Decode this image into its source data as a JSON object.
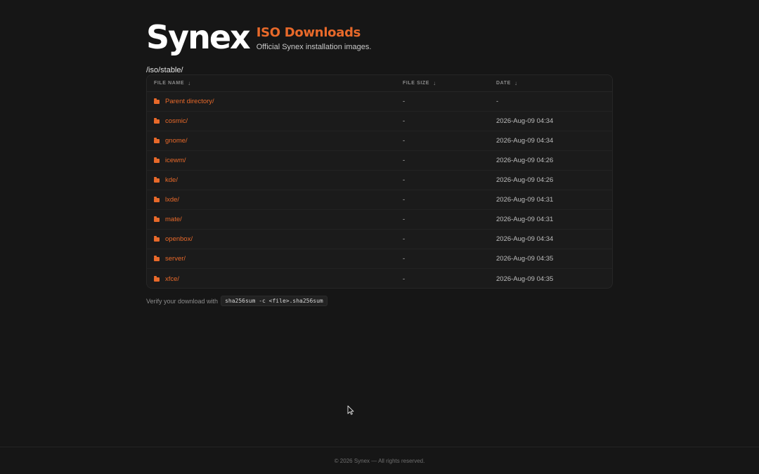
{
  "brand": {
    "logo_text": "Synex",
    "title": "ISO Downloads",
    "subtitle": "Official Synex installation images."
  },
  "path": "/iso/stable/",
  "table": {
    "headers": {
      "name": "File Name",
      "size": "File Size",
      "date": "Date",
      "sort_glyph": "↓"
    },
    "rows": [
      {
        "name": "Parent directory/",
        "size": "-",
        "date": "-"
      },
      {
        "name": "cosmic/",
        "size": "-",
        "date": "2026-Aug-09 04:34"
      },
      {
        "name": "gnome/",
        "size": "-",
        "date": "2026-Aug-09 04:34"
      },
      {
        "name": "icewm/",
        "size": "-",
        "date": "2026-Aug-09 04:26"
      },
      {
        "name": "kde/",
        "size": "-",
        "date": "2026-Aug-09 04:26"
      },
      {
        "name": "lxde/",
        "size": "-",
        "date": "2026-Aug-09 04:31"
      },
      {
        "name": "mate/",
        "size": "-",
        "date": "2026-Aug-09 04:31"
      },
      {
        "name": "openbox/",
        "size": "-",
        "date": "2026-Aug-09 04:34"
      },
      {
        "name": "server/",
        "size": "-",
        "date": "2026-Aug-09 04:35"
      },
      {
        "name": "xfce/",
        "size": "-",
        "date": "2026-Aug-09 04:35"
      }
    ]
  },
  "verify": {
    "text": "Verify your download with",
    "command": "sha256sum -c <file>.sha256sum"
  },
  "footer": {
    "text": "© 2026 Synex — All rights reserved."
  },
  "colors": {
    "accent": "#e8692a",
    "background": "#161616",
    "panel": "#1b1b1b"
  },
  "icons": {
    "row_icon": "folder-icon",
    "sort_icon": "sort-down-icon",
    "pointer": "mouse-cursor-icon"
  }
}
